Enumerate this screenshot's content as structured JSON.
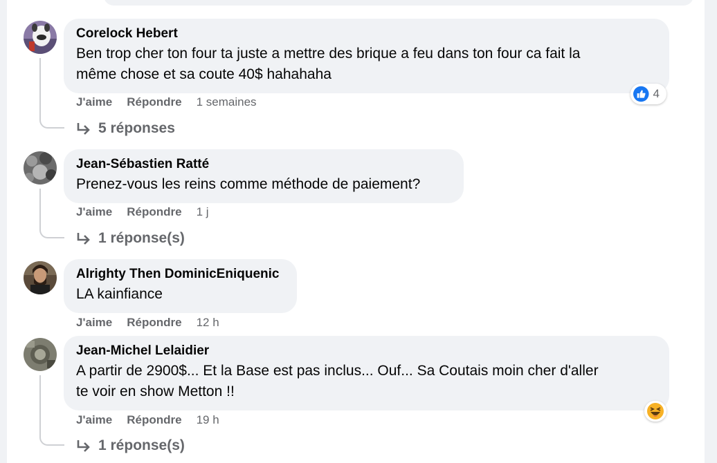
{
  "comments": [
    {
      "author": "Corelock Hebert",
      "text_lines": [
        "Ben trop cher ton four ta juste a mettre des brique a feu dans ton four ca fait la",
        "même chose et sa coute 40$ hahahaha"
      ],
      "like_label": "J'aime",
      "reply_label": "Répondre",
      "time": "1 semaines",
      "reaction": {
        "icon": "like-reaction-icon",
        "count": "4"
      },
      "replies": "5 réponses"
    },
    {
      "author": "Jean-Sébastien Ratté",
      "text_lines": [
        "Prenez-vous les reins comme méthode de paiement?"
      ],
      "like_label": "J'aime",
      "reply_label": "Répondre",
      "time": "1 j",
      "replies": "1 réponse(s)"
    },
    {
      "author": "Alrighty Then DominicEniquenic",
      "text_lines": [
        "LA kainfiance"
      ],
      "like_label": "J'aime",
      "reply_label": "Répondre",
      "time": "12 h"
    },
    {
      "author": "Jean-Michel Lelaidier",
      "text_lines": [
        "A partir de 2900$... Et la Base est pas inclus... Ouf... Sa Coutais moin cher d'aller",
        "te voir en show Metton !!"
      ],
      "like_label": "J'aime",
      "reply_label": "Répondre",
      "time": "19 h",
      "reaction": {
        "icon": "haha-reaction-icon"
      },
      "replies": "1 réponse(s)"
    }
  ],
  "colors": {
    "page_bg": "#f0f2f5",
    "bubble_bg": "#f0f2f5",
    "secondary_text": "#65676b",
    "like_blue": "#1877f2",
    "haha_yellow": "#f7b125"
  }
}
